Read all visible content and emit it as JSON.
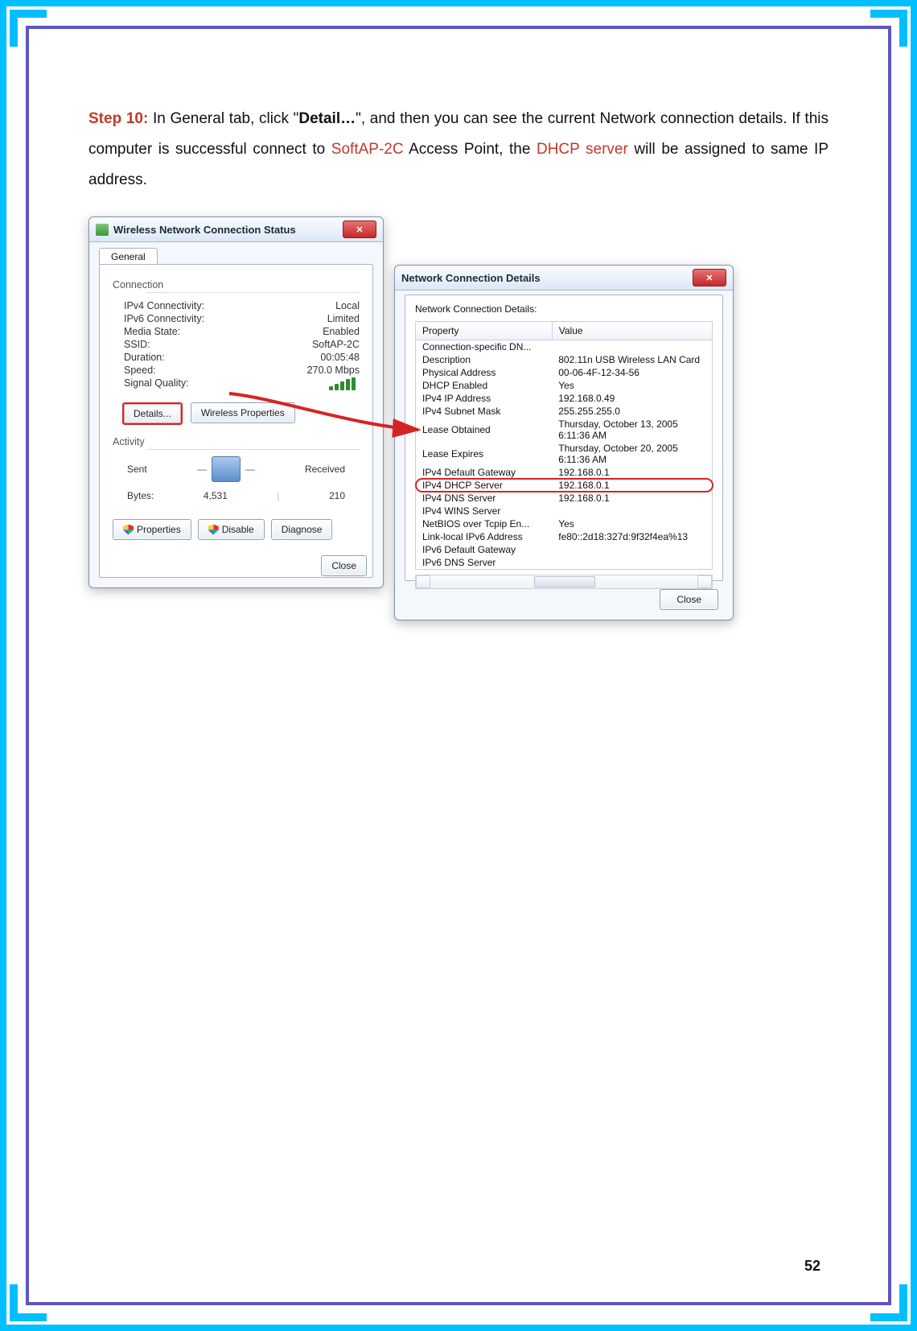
{
  "instruction": {
    "step_label": "Step 10:",
    "t1": " In General tab, click \"",
    "bold": "Detail…",
    "t2": "\", and then you can see the current Network connection details. If this computer is successful connect to ",
    "hl1": "SoftAP-2C",
    "t3": " Access Point, the ",
    "hl2": "DHCP server",
    "t4": " will be assigned to same IP address."
  },
  "status_dialog": {
    "title": "Wireless Network Connection Status",
    "tab": "General",
    "connection_heading": "Connection",
    "rows": {
      "ipv4c_label": "IPv4 Connectivity:",
      "ipv4c_value": "Local",
      "ipv6c_label": "IPv6 Connectivity:",
      "ipv6c_value": "Limited",
      "media_label": "Media State:",
      "media_value": "Enabled",
      "ssid_label": "SSID:",
      "ssid_value": "SoftAP-2C",
      "dur_label": "Duration:",
      "dur_value": "00:05:48",
      "speed_label": "Speed:",
      "speed_value": "270.0 Mbps",
      "sig_label": "Signal Quality:"
    },
    "details_btn": "Details...",
    "wprops_btn": "Wireless Properties",
    "activity_heading": "Activity",
    "sent_label": "Sent",
    "recv_label": "Received",
    "bytes_label": "Bytes:",
    "bytes_sent": "4,531",
    "bytes_recv": "210",
    "properties_btn": "Properties",
    "disable_btn": "Disable",
    "diagnose_btn": "Diagnose",
    "close_btn": "Close"
  },
  "details_dialog": {
    "title": "Network Connection Details",
    "subtitle": "Network Connection Details:",
    "header_prop": "Property",
    "header_val": "Value",
    "rows": [
      {
        "p": "Connection-specific DN...",
        "v": ""
      },
      {
        "p": "Description",
        "v": "802.11n USB Wireless LAN Card"
      },
      {
        "p": "Physical Address",
        "v": "00-06-4F-12-34-56"
      },
      {
        "p": "DHCP Enabled",
        "v": "Yes"
      },
      {
        "p": "IPv4 IP Address",
        "v": "192.168.0.49"
      },
      {
        "p": "IPv4 Subnet Mask",
        "v": "255.255.255.0"
      },
      {
        "p": "Lease Obtained",
        "v": "Thursday, October 13, 2005 6:11:36 AM"
      },
      {
        "p": "Lease Expires",
        "v": "Thursday, October 20, 2005 6:11:36 AM"
      },
      {
        "p": "IPv4 Default Gateway",
        "v": "192.168.0.1"
      },
      {
        "p": "IPv4 DHCP Server",
        "v": "192.168.0.1"
      },
      {
        "p": "IPv4 DNS Server",
        "v": "192.168.0.1"
      },
      {
        "p": "IPv4 WINS Server",
        "v": ""
      },
      {
        "p": "NetBIOS over Tcpip En...",
        "v": "Yes"
      },
      {
        "p": "Link-local IPv6 Address",
        "v": "fe80::2d18:327d:9f32f4ea%13"
      },
      {
        "p": "IPv6 Default Gateway",
        "v": ""
      },
      {
        "p": "IPv6 DNS Server",
        "v": ""
      }
    ],
    "highlight_index": 9,
    "close_btn": "Close"
  },
  "page_number": "52"
}
